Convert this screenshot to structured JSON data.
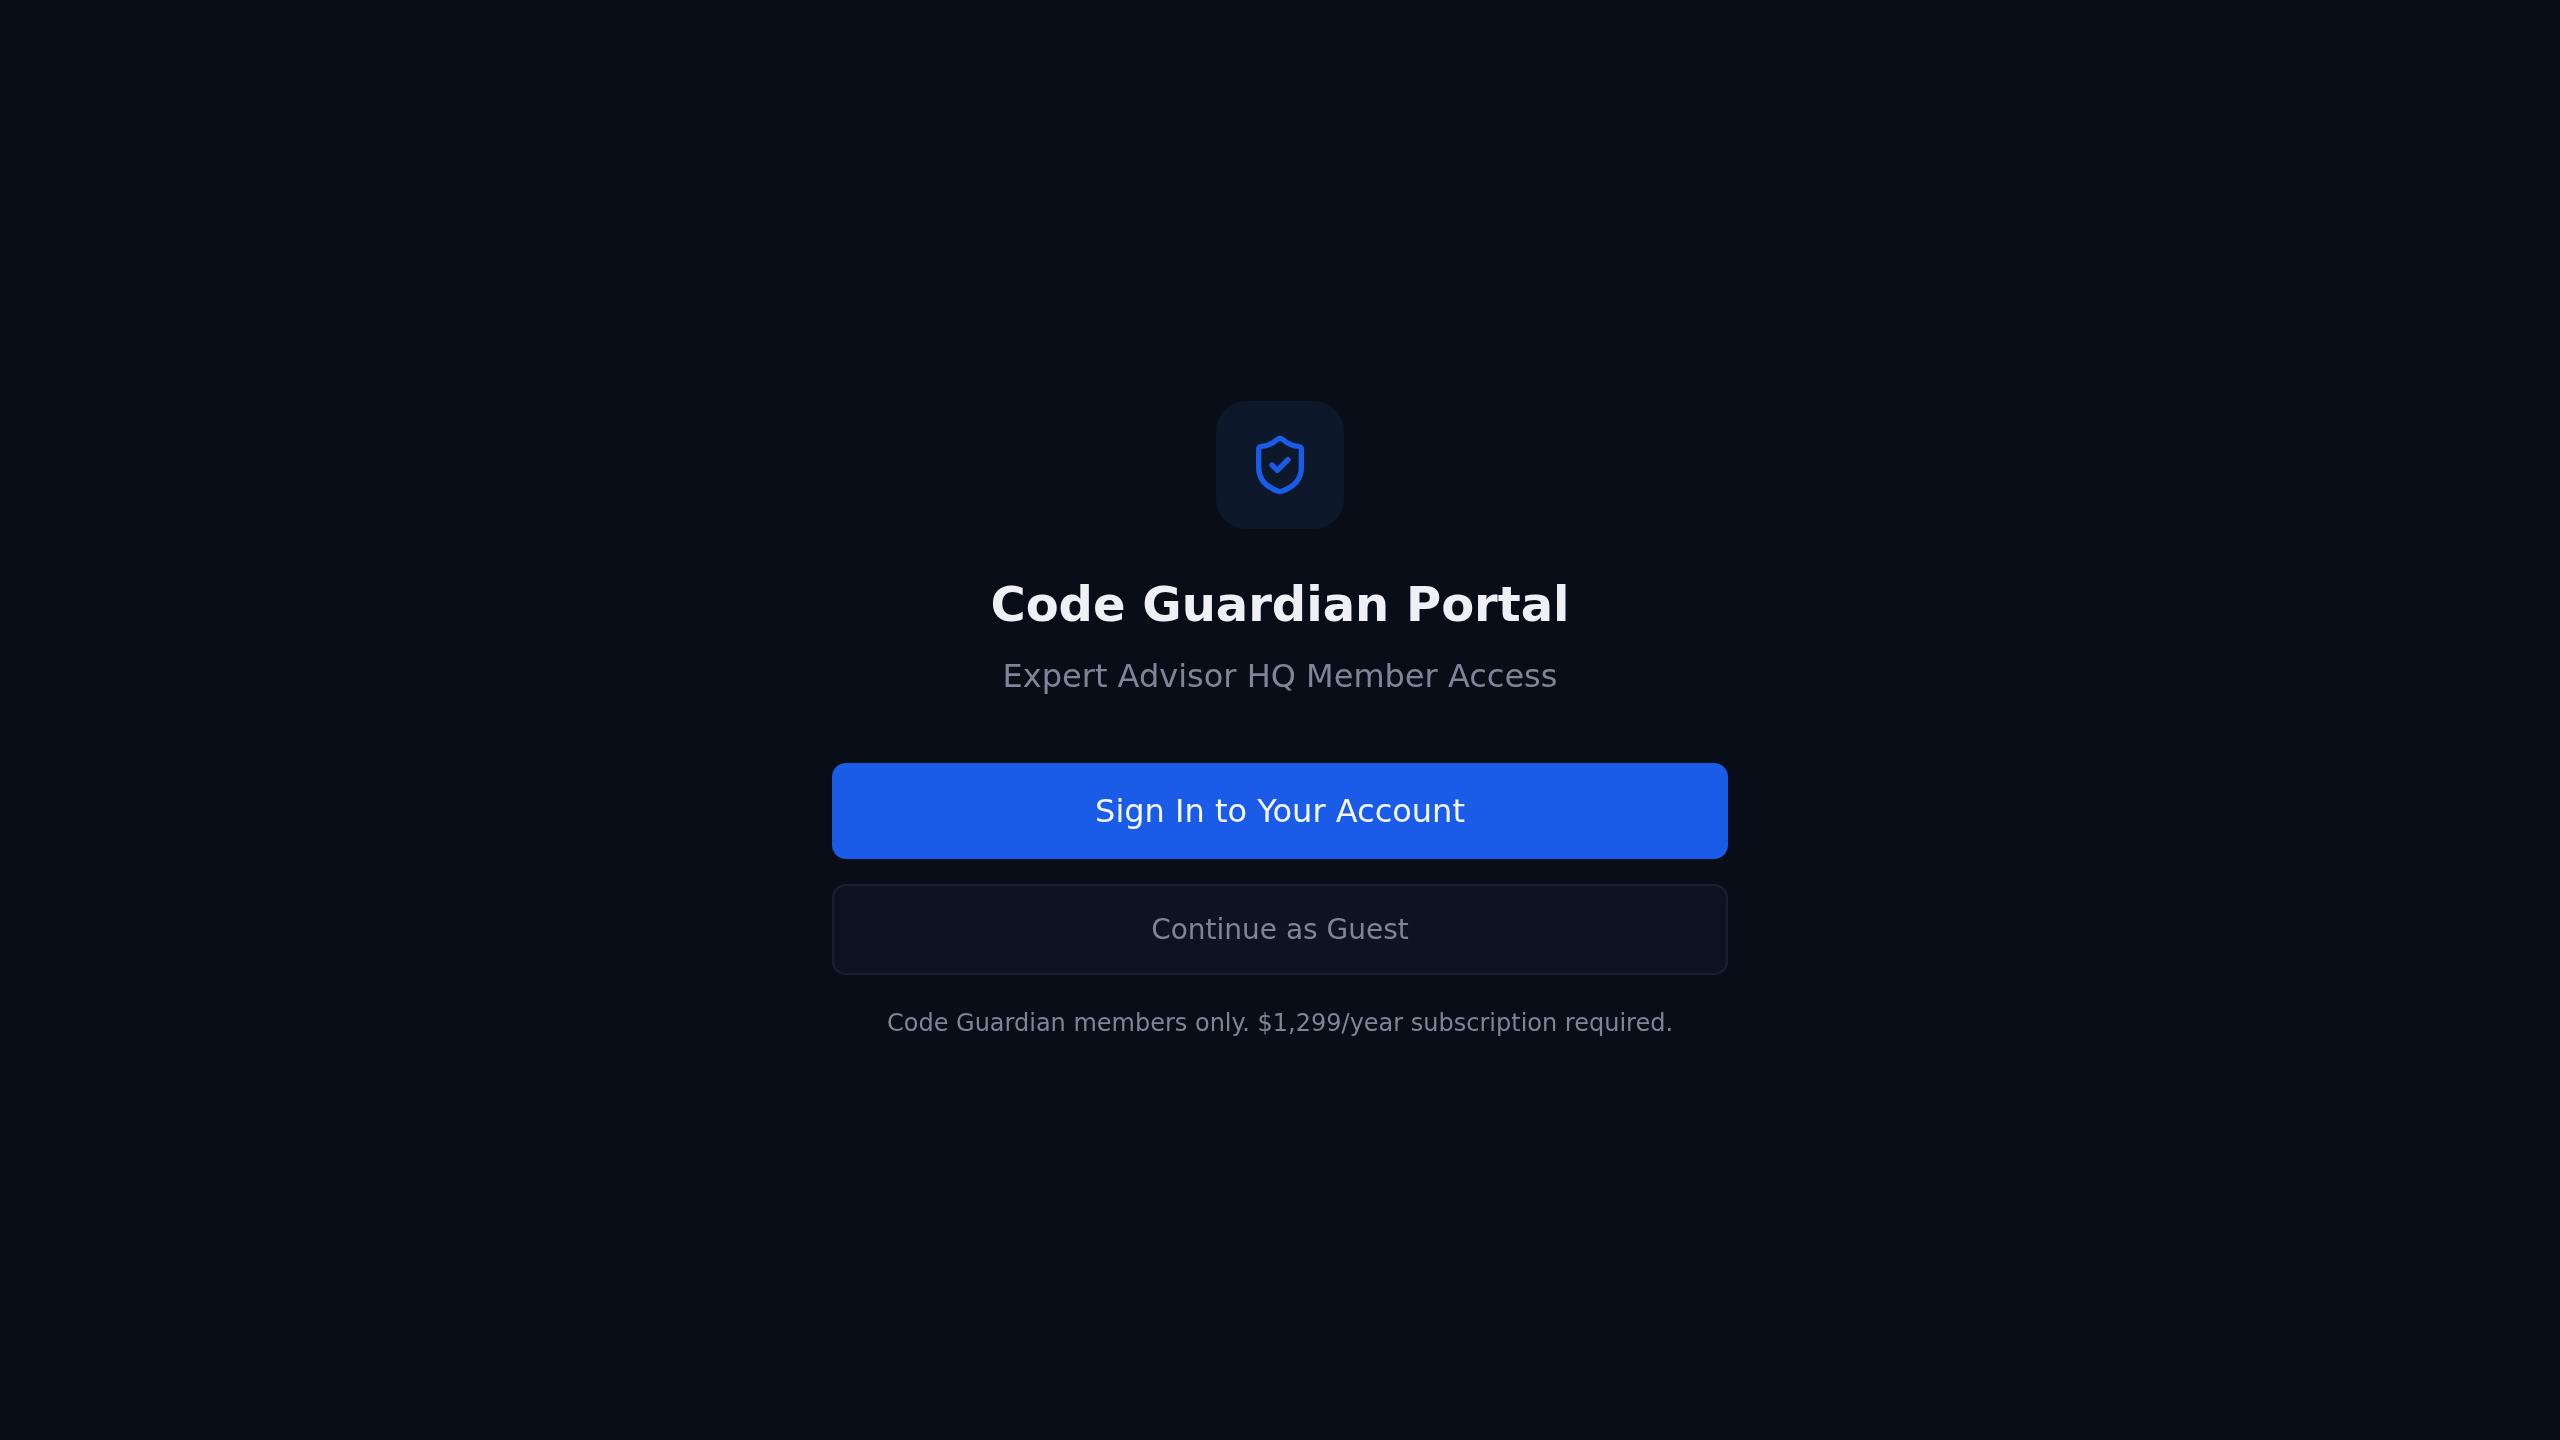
{
  "title": "Code Guardian Portal",
  "subtitle": "Expert Advisor HQ Member Access",
  "buttons": [
    {
      "label": "Sign In to Your Account",
      "kind": "primary"
    },
    {
      "label": "Continue as Guest",
      "kind": "secondary"
    }
  ],
  "footnote": "Code Guardian members only. $1,299/year subscription required."
}
